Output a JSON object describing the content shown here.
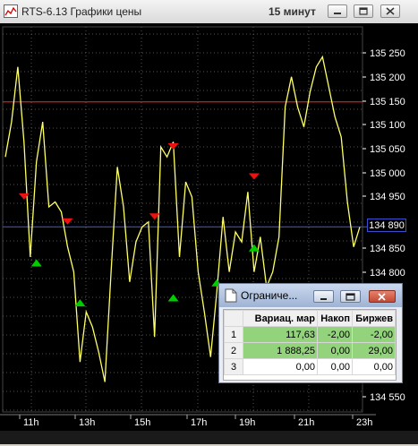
{
  "window": {
    "title": "RTS-6.13 Графики цены",
    "interval": "15 минут"
  },
  "chart": {
    "y_labels": [
      "135 250",
      "135 200",
      "135 150",
      "135 100",
      "135 050",
      "135 000",
      "134 950",
      "134 850",
      "134 800",
      "134 550"
    ],
    "current_price": "134 890",
    "x_labels": [
      "11h",
      "13h",
      "15h",
      "17h",
      "19h",
      "21h",
      "23h"
    ]
  },
  "chart_data": {
    "type": "line",
    "ylim": [
      134520,
      135290
    ],
    "x": [
      0,
      1,
      2,
      3,
      4,
      5,
      6,
      7,
      8,
      9,
      10,
      11,
      12,
      13,
      14,
      15,
      16,
      17,
      18,
      19,
      20,
      21,
      22,
      23,
      24,
      25,
      26,
      27,
      28,
      29,
      30,
      31,
      32,
      33,
      34,
      35,
      36,
      37,
      38,
      39,
      40,
      41,
      42,
      43,
      44,
      45,
      46,
      47,
      48,
      49,
      50,
      51,
      52,
      53,
      54,
      55,
      56,
      57,
      58,
      59,
      60,
      61,
      62,
      63,
      64,
      65,
      66,
      67,
      68
    ],
    "values": [
      135030,
      135100,
      135210,
      135060,
      134830,
      135020,
      135100,
      134930,
      134940,
      134920,
      134850,
      134800,
      134620,
      134720,
      134690,
      134640,
      134580,
      134800,
      135010,
      134930,
      134780,
      134860,
      134890,
      134900,
      134670,
      135050,
      135030,
      135060,
      134830,
      134980,
      134950,
      134800,
      134720,
      134630,
      134760,
      134910,
      134800,
      134880,
      134860,
      134960,
      134800,
      134870,
      134770,
      134800,
      134870,
      135130,
      135190,
      135130,
      135090,
      135160,
      135210,
      135230,
      135170,
      135110,
      135070,
      134940,
      134850,
      134890
    ],
    "buy_markers": [
      134740,
      134750,
      134780,
      134850,
      134820
    ],
    "sell_markers": [
      134900,
      134910,
      135050,
      134990,
      134950
    ],
    "hlines": {
      "red": 135140,
      "blue": 134890
    }
  },
  "popup": {
    "title": "Ограниче...",
    "columns": [
      "Вариац. мар",
      "Накоп",
      "Биржев"
    ],
    "rows": [
      {
        "n": "1",
        "vals": [
          "117,63",
          "-2,00",
          "-2,00"
        ],
        "highlight": true
      },
      {
        "n": "2",
        "vals": [
          "1 888,25",
          "0,00",
          "29,00"
        ],
        "highlight": true
      },
      {
        "n": "3",
        "vals": [
          "0,00",
          "0,00",
          "0,00"
        ],
        "highlight": false
      }
    ]
  },
  "colors": {
    "line": "#ffff66",
    "buy": "#00cc00",
    "sell": "#ee1111",
    "hline_red": "#cc2222",
    "hline_blue": "#3344cc",
    "highlight": "#92d37c"
  }
}
